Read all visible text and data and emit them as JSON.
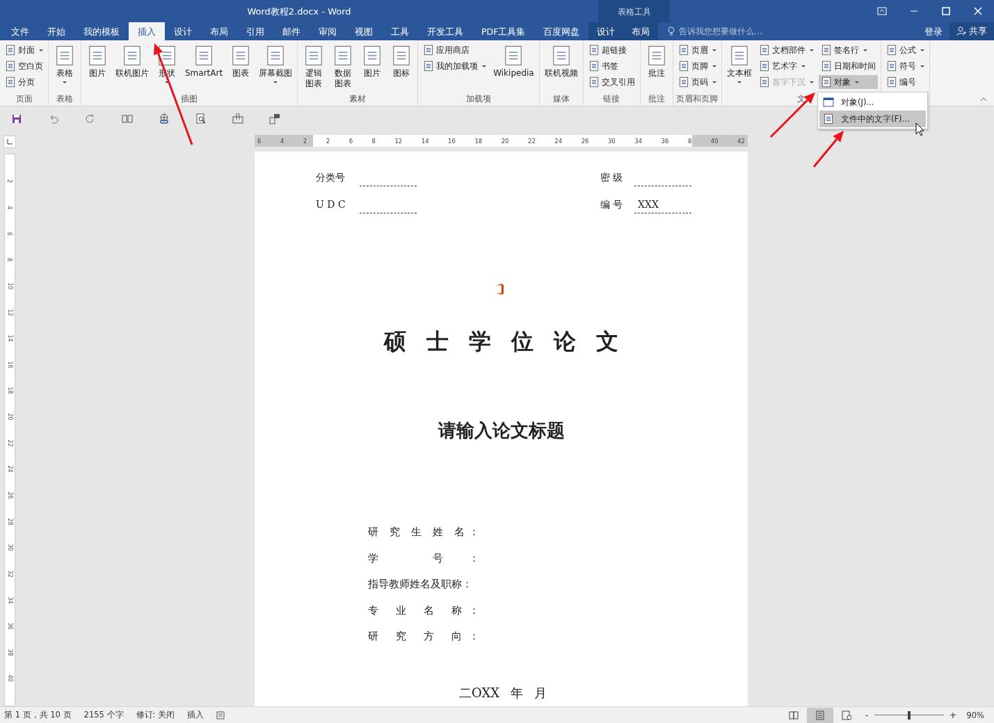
{
  "window": {
    "title": "Word教程2.docx - Word",
    "context_group": "表格工具"
  },
  "tabs": [
    {
      "label": "文件",
      "selected": false,
      "kind": "normal"
    },
    {
      "label": "开始",
      "selected": false,
      "kind": "normal"
    },
    {
      "label": "我的模板",
      "selected": false,
      "kind": "normal"
    },
    {
      "label": "插入",
      "selected": true,
      "kind": "normal"
    },
    {
      "label": "设计",
      "selected": false,
      "kind": "normal"
    },
    {
      "label": "布局",
      "selected": false,
      "kind": "normal"
    },
    {
      "label": "引用",
      "selected": false,
      "kind": "normal"
    },
    {
      "label": "邮件",
      "selected": false,
      "kind": "normal"
    },
    {
      "label": "审阅",
      "selected": false,
      "kind": "normal"
    },
    {
      "label": "视图",
      "selected": false,
      "kind": "normal"
    },
    {
      "label": "工具",
      "selected": false,
      "kind": "normal"
    },
    {
      "label": "开发工具",
      "selected": false,
      "kind": "normal"
    },
    {
      "label": "PDF工具集",
      "selected": false,
      "kind": "normal"
    },
    {
      "label": "百度网盘",
      "selected": false,
      "kind": "normal"
    },
    {
      "label": "设计",
      "selected": false,
      "kind": "context"
    },
    {
      "label": "布局",
      "selected": false,
      "kind": "context"
    }
  ],
  "tell_me": {
    "placeholder": "告诉我您想要做什么..."
  },
  "account": {
    "login": "登录",
    "share": "共享"
  },
  "ribbon": {
    "groups": [
      {
        "label": "页面",
        "items": [
          {
            "kind": "stack",
            "items": [
              {
                "label": "封面",
                "dropdown": true,
                "disabled": false,
                "selected": false
              },
              {
                "label": "空白页",
                "dropdown": false,
                "disabled": false,
                "selected": false
              },
              {
                "label": "分页",
                "dropdown": false,
                "disabled": false,
                "selected": false
              }
            ]
          }
        ]
      },
      {
        "label": "表格",
        "items": [
          {
            "kind": "large",
            "label": "表格",
            "dropdown": true
          }
        ]
      },
      {
        "label": "插图",
        "items": [
          {
            "kind": "large",
            "label": "图片",
            "dropdown": false
          },
          {
            "kind": "large",
            "label": "联机图片",
            "dropdown": false
          },
          {
            "kind": "large",
            "label": "形状",
            "dropdown": true
          },
          {
            "kind": "large",
            "label": "SmartArt",
            "dropdown": false
          },
          {
            "kind": "large",
            "label": "图表",
            "dropdown": false
          },
          {
            "kind": "large",
            "label": "屏幕截图",
            "dropdown": true
          }
        ]
      },
      {
        "label": "素材",
        "items": [
          {
            "kind": "narrow",
            "label": "逻辑图表",
            "dropdown": false
          },
          {
            "kind": "narrow",
            "label": "数据图表",
            "dropdown": false
          },
          {
            "kind": "large",
            "label": "图片",
            "dropdown": false
          },
          {
            "kind": "large",
            "label": "图标",
            "dropdown": false
          }
        ]
      },
      {
        "label": "加载项",
        "items": [
          {
            "kind": "stack",
            "items": [
              {
                "label": "应用商店",
                "dropdown": false,
                "disabled": false,
                "selected": false
              },
              {
                "label": "我的加载项",
                "dropdown": true,
                "disabled": false,
                "selected": false
              }
            ]
          },
          {
            "kind": "large",
            "label": "Wikipedia",
            "dropdown": false
          }
        ]
      },
      {
        "label": "媒体",
        "items": [
          {
            "kind": "large",
            "label": "联机视频",
            "dropdown": false
          }
        ]
      },
      {
        "label": "链接",
        "items": [
          {
            "kind": "stack",
            "items": [
              {
                "label": "超链接",
                "dropdown": false,
                "disabled": false,
                "selected": false
              },
              {
                "label": "书签",
                "dropdown": false,
                "disabled": false,
                "selected": false
              },
              {
                "label": "交叉引用",
                "dropdown": false,
                "disabled": false,
                "selected": false
              }
            ]
          }
        ]
      },
      {
        "label": "批注",
        "items": [
          {
            "kind": "large",
            "label": "批注",
            "dropdown": false
          }
        ]
      },
      {
        "label": "页眉和页脚",
        "items": [
          {
            "kind": "stack",
            "items": [
              {
                "label": "页眉",
                "dropdown": true,
                "disabled": false,
                "selected": false
              },
              {
                "label": "页脚",
                "dropdown": true,
                "disabled": false,
                "selected": false
              },
              {
                "label": "页码",
                "dropdown": true,
                "disabled": false,
                "selected": false
              }
            ]
          }
        ]
      },
      {
        "label": "文",
        "items": [
          {
            "kind": "large",
            "label": "文本框",
            "dropdown": true
          },
          {
            "kind": "stack",
            "items": [
              {
                "label": "文档部件",
                "dropdown": true,
                "disabled": false,
                "selected": false
              },
              {
                "label": "艺术字",
                "dropdown": true,
                "disabled": false,
                "selected": false
              },
              {
                "label": "首字下沉",
                "dropdown": true,
                "disabled": true,
                "selected": false
              }
            ]
          },
          {
            "kind": "stack",
            "items": [
              {
                "label": "签名行",
                "dropdown": true,
                "disabled": false,
                "selected": false
              },
              {
                "label": "日期和时间",
                "dropdown": false,
                "disabled": false,
                "selected": false
              },
              {
                "label": "对象",
                "dropdown": true,
                "disabled": false,
                "selected": true
              }
            ]
          }
        ]
      },
      {
        "items": [
          {
            "kind": "stack",
            "items": [
              {
                "label": "公式",
                "dropdown": true,
                "disabled": false,
                "selected": false
              },
              {
                "label": "符号",
                "dropdown": true,
                "disabled": false,
                "selected": false
              },
              {
                "label": "编号",
                "dropdown": false,
                "disabled": false,
                "selected": false
              }
            ]
          }
        ]
      }
    ]
  },
  "dropdown_menu": {
    "items": [
      {
        "label": "对象(J)...",
        "selected": false
      },
      {
        "label": "文件中的文字(F)...",
        "selected": true
      }
    ]
  },
  "ruler": {
    "numbers": [
      "6",
      "4",
      "2",
      "2",
      "6",
      "8",
      "12",
      "14",
      "16",
      "18",
      "20",
      "22",
      "24",
      "26",
      "30",
      "34",
      "36",
      "8",
      "40",
      "42"
    ]
  },
  "vertical_ruler": {
    "numbers": [
      "2",
      "4",
      "6",
      "8",
      "10",
      "12",
      "14",
      "16",
      "18",
      "20",
      "22",
      "24",
      "26",
      "28",
      "30",
      "32",
      "34",
      "36",
      "38",
      "40"
    ]
  },
  "document": {
    "header_fields": [
      {
        "label": "分类号"
      },
      {
        "label": "密 级"
      },
      {
        "label": "U D C"
      },
      {
        "label": "编 号",
        "value": "XXX"
      }
    ],
    "title": "硕 士 学 位 论 文",
    "subtitle": "请输入论文标题",
    "info_lines": [
      "研 究 生 姓 名：",
      "学 号：",
      "指导教师姓名及职称：",
      "专 业 名 称：",
      "研 究 方 向："
    ],
    "date": "二OXX 年 月"
  },
  "status_bar": {
    "items": [
      "第 1 页，共 10 页",
      "2155 个字",
      "修订: 关闭",
      "插入"
    ],
    "views": [
      {
        "selected": false
      },
      {
        "selected": true
      },
      {
        "selected": false
      }
    ],
    "zoom": {
      "level": 0.5,
      "reading": "90%",
      "out": "-",
      "in": "+"
    }
  }
}
